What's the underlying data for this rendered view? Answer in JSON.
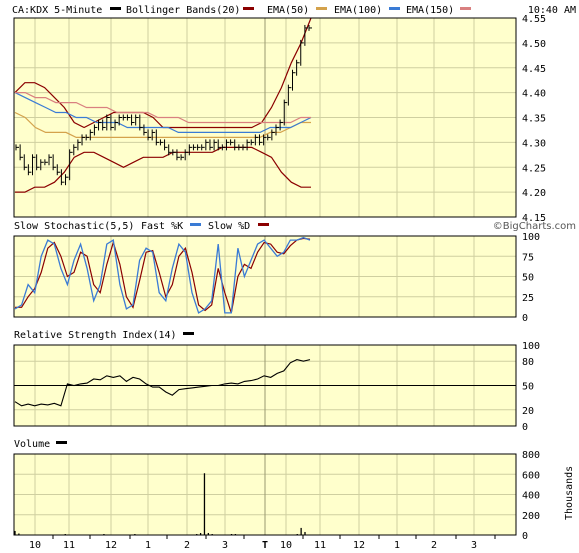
{
  "header": {
    "symbol": "CA:KDX 5-Minute",
    "legend": [
      {
        "label": "Bollinger Bands(20)",
        "color": "#8b0000"
      },
      {
        "label": "EMA(50)",
        "color": "#d4a24c"
      },
      {
        "label": "EMA(100)",
        "color": "#3a7bd5"
      },
      {
        "label": "EMA(150)",
        "color": "#d98080"
      }
    ],
    "time": "10:40 AM"
  },
  "watermark": "©BigCharts.com",
  "colors": {
    "background": "#ffffcc",
    "grid": "#cfcfa0",
    "price": "#000000",
    "bollinger": "#8b0000",
    "ema50": "#d4a24c",
    "ema100": "#3a7bd5",
    "ema150": "#d98080",
    "stoch_fast": "#3a7bd5",
    "stoch_slow": "#8b0000"
  },
  "x_axis": {
    "labels": [
      "10",
      "11",
      "12",
      "1",
      "2",
      "3",
      "T",
      "10",
      "11",
      "12",
      "1",
      "2",
      "3"
    ]
  },
  "chart_data": [
    {
      "type": "line",
      "name": "price",
      "title": "CA:KDX 5-Minute",
      "ylim": [
        4.15,
        4.55
      ],
      "y_ticks": [
        4.55,
        4.5,
        4.45,
        4.4,
        4.35,
        4.3,
        4.25,
        4.2,
        4.15
      ],
      "series": [
        {
          "name": "Price",
          "values": [
            4.29,
            4.27,
            4.25,
            4.24,
            4.27,
            4.25,
            4.26,
            4.26,
            4.27,
            4.25,
            4.24,
            4.22,
            4.23,
            4.28,
            4.29,
            4.3,
            4.31,
            4.31,
            4.32,
            4.33,
            4.34,
            4.33,
            4.35,
            4.33,
            4.34,
            4.35,
            4.35,
            4.35,
            4.34,
            4.35,
            4.33,
            4.32,
            4.31,
            4.32,
            4.3,
            4.3,
            4.29,
            4.28,
            4.28,
            4.27,
            4.27,
            4.28,
            4.29,
            4.29,
            4.29,
            4.29,
            4.3,
            4.29,
            4.3,
            4.29,
            4.29,
            4.3,
            4.3,
            4.29,
            4.29,
            4.29,
            4.3,
            4.3,
            4.31,
            4.3,
            4.31,
            4.31,
            4.32,
            4.33,
            4.34,
            4.38,
            4.41,
            4.44,
            4.46,
            4.5,
            4.53,
            4.53
          ]
        },
        {
          "name": "Bollinger Upper",
          "values": [
            4.4,
            4.42,
            4.42,
            4.41,
            4.39,
            4.37,
            4.34,
            4.33,
            4.34,
            4.35,
            4.36,
            4.36,
            4.36,
            4.36,
            4.35,
            4.33,
            4.33,
            4.33,
            4.33,
            4.33,
            4.33,
            4.33,
            4.33,
            4.33,
            4.33,
            4.34,
            4.37,
            4.41,
            4.46,
            4.5,
            4.55
          ]
        },
        {
          "name": "Bollinger Lower",
          "values": [
            4.2,
            4.2,
            4.21,
            4.21,
            4.22,
            4.24,
            4.27,
            4.28,
            4.28,
            4.27,
            4.26,
            4.25,
            4.26,
            4.27,
            4.27,
            4.27,
            4.28,
            4.28,
            4.28,
            4.28,
            4.28,
            4.29,
            4.29,
            4.29,
            4.29,
            4.28,
            4.27,
            4.24,
            4.22,
            4.21,
            4.21
          ]
        },
        {
          "name": "EMA(50)",
          "values": [
            4.36,
            4.35,
            4.33,
            4.32,
            4.32,
            4.32,
            4.31,
            4.31,
            4.31,
            4.31,
            4.31,
            4.31,
            4.31,
            4.31,
            4.31,
            4.31,
            4.31,
            4.31,
            4.31,
            4.31,
            4.31,
            4.31,
            4.31,
            4.31,
            4.31,
            4.32,
            4.32,
            4.33,
            4.34,
            4.34
          ]
        },
        {
          "name": "EMA(100)",
          "values": [
            4.4,
            4.39,
            4.38,
            4.37,
            4.36,
            4.36,
            4.35,
            4.35,
            4.34,
            4.34,
            4.34,
            4.33,
            4.33,
            4.33,
            4.33,
            4.33,
            4.32,
            4.32,
            4.32,
            4.32,
            4.32,
            4.32,
            4.32,
            4.32,
            4.32,
            4.33,
            4.33,
            4.33,
            4.34,
            4.35
          ]
        },
        {
          "name": "EMA(150)",
          "values": [
            4.4,
            4.4,
            4.39,
            4.39,
            4.38,
            4.38,
            4.38,
            4.37,
            4.37,
            4.37,
            4.36,
            4.36,
            4.36,
            4.36,
            4.35,
            4.35,
            4.35,
            4.34,
            4.34,
            4.34,
            4.34,
            4.34,
            4.34,
            4.34,
            4.34,
            4.34,
            4.34,
            4.34,
            4.35,
            4.35
          ]
        }
      ]
    },
    {
      "type": "line",
      "name": "stochastic",
      "title": "Slow Stochastic(5,5)",
      "legend": [
        {
          "label": "Fast %K",
          "color": "#3a7bd5"
        },
        {
          "label": "Slow %D",
          "color": "#8b0000"
        }
      ],
      "ylim": [
        0,
        100
      ],
      "y_ticks": [
        100,
        75,
        50,
        25,
        0
      ],
      "series": [
        {
          "name": "Fast %K",
          "values": [
            10,
            15,
            40,
            30,
            75,
            95,
            90,
            60,
            40,
            70,
            90,
            60,
            20,
            40,
            90,
            95,
            40,
            10,
            15,
            70,
            85,
            80,
            30,
            20,
            60,
            90,
            80,
            30,
            5,
            10,
            20,
            90,
            5,
            5,
            85,
            50,
            70,
            90,
            95,
            85,
            75,
            80,
            95,
            95,
            98,
            95
          ]
        },
        {
          "name": "Slow %D",
          "values": [
            12,
            12,
            25,
            35,
            55,
            85,
            92,
            75,
            50,
            55,
            80,
            75,
            40,
            30,
            65,
            92,
            65,
            25,
            12,
            45,
            80,
            82,
            55,
            25,
            40,
            75,
            85,
            55,
            15,
            8,
            15,
            60,
            30,
            5,
            50,
            65,
            60,
            80,
            92,
            90,
            80,
            78,
            88,
            95,
            97,
            96
          ]
        }
      ]
    },
    {
      "type": "line",
      "name": "rsi",
      "title": "Relative Strength Index(14)",
      "ylim": [
        0,
        100
      ],
      "y_ticks": [
        100,
        80,
        50,
        20,
        0
      ],
      "series": [
        {
          "name": "RSI",
          "values": [
            30,
            25,
            27,
            25,
            27,
            26,
            28,
            25,
            52,
            50,
            52,
            53,
            58,
            57,
            62,
            60,
            62,
            55,
            60,
            58,
            52,
            48,
            48,
            42,
            38,
            45,
            46,
            47,
            48,
            49,
            50,
            50,
            52,
            53,
            52,
            55,
            56,
            58,
            62,
            60,
            65,
            68,
            78,
            82,
            80,
            82
          ]
        }
      ]
    },
    {
      "type": "bar",
      "name": "volume",
      "title": "Volume",
      "ylabel": "Thousands",
      "ylim": [
        0,
        800
      ],
      "y_ticks": [
        800,
        600,
        400,
        200,
        0
      ],
      "series": [
        {
          "name": "Volume",
          "values": [
            40,
            15,
            5,
            0,
            0,
            0,
            0,
            0,
            5,
            5,
            0,
            0,
            0,
            10,
            0,
            0,
            5,
            0,
            0,
            0,
            0,
            0,
            0,
            10,
            0,
            0,
            0,
            0,
            0,
            0,
            5,
            10,
            0,
            0,
            0,
            0,
            0,
            0,
            5,
            0,
            0,
            0,
            0,
            0,
            0,
            0,
            5,
            10,
            20,
            610,
            20,
            10,
            5,
            0,
            5,
            5,
            10,
            10,
            5,
            5,
            5,
            5,
            5,
            5,
            5,
            5,
            5,
            5,
            5,
            5,
            5,
            5,
            5,
            10,
            70,
            30
          ]
        }
      ]
    }
  ]
}
